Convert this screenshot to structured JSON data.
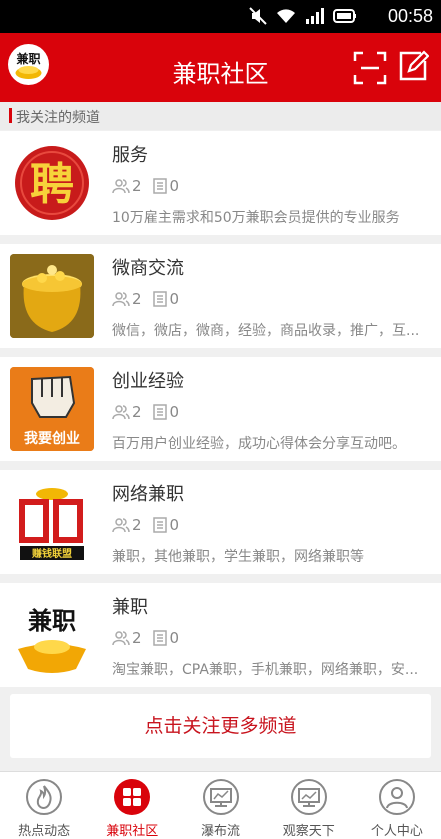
{
  "status": {
    "time": "00:58"
  },
  "header": {
    "title": "兼职社区",
    "logo_text": "兼职"
  },
  "section": {
    "label": "我关注的频道"
  },
  "channels": [
    {
      "name": "服务",
      "members": "2",
      "posts": "0",
      "desc": "10万雇主需求和50万兼职会员提供的专业服务",
      "thumb_text": "聘"
    },
    {
      "name": "微商交流",
      "members": "2",
      "posts": "0",
      "desc": "微信，微店，微商，经验，商品收录，推广，互...",
      "thumb_text": ""
    },
    {
      "name": "创业经验",
      "members": "2",
      "posts": "0",
      "desc": "百万用户创业经验，成功心得体会分享互动吧。",
      "thumb_text": "我要创业"
    },
    {
      "name": "网络兼职",
      "members": "2",
      "posts": "0",
      "desc": "兼职，其他兼职，学生兼职，网络兼职等",
      "thumb_text": "赚钱联盟"
    },
    {
      "name": "兼职",
      "members": "2",
      "posts": "0",
      "desc": "淘宝兼职，CPA兼职，手机兼职，网络兼职，安...",
      "thumb_text": "兼职"
    }
  ],
  "more_button": "点击关注更多频道",
  "tabs": [
    {
      "label": "热点动态",
      "icon": "flame-icon"
    },
    {
      "label": "兼职社区",
      "icon": "grid-icon"
    },
    {
      "label": "瀑布流",
      "icon": "monitor-icon"
    },
    {
      "label": "观察天下",
      "icon": "chart-monitor-icon"
    },
    {
      "label": "个人中心",
      "icon": "person-icon"
    }
  ]
}
